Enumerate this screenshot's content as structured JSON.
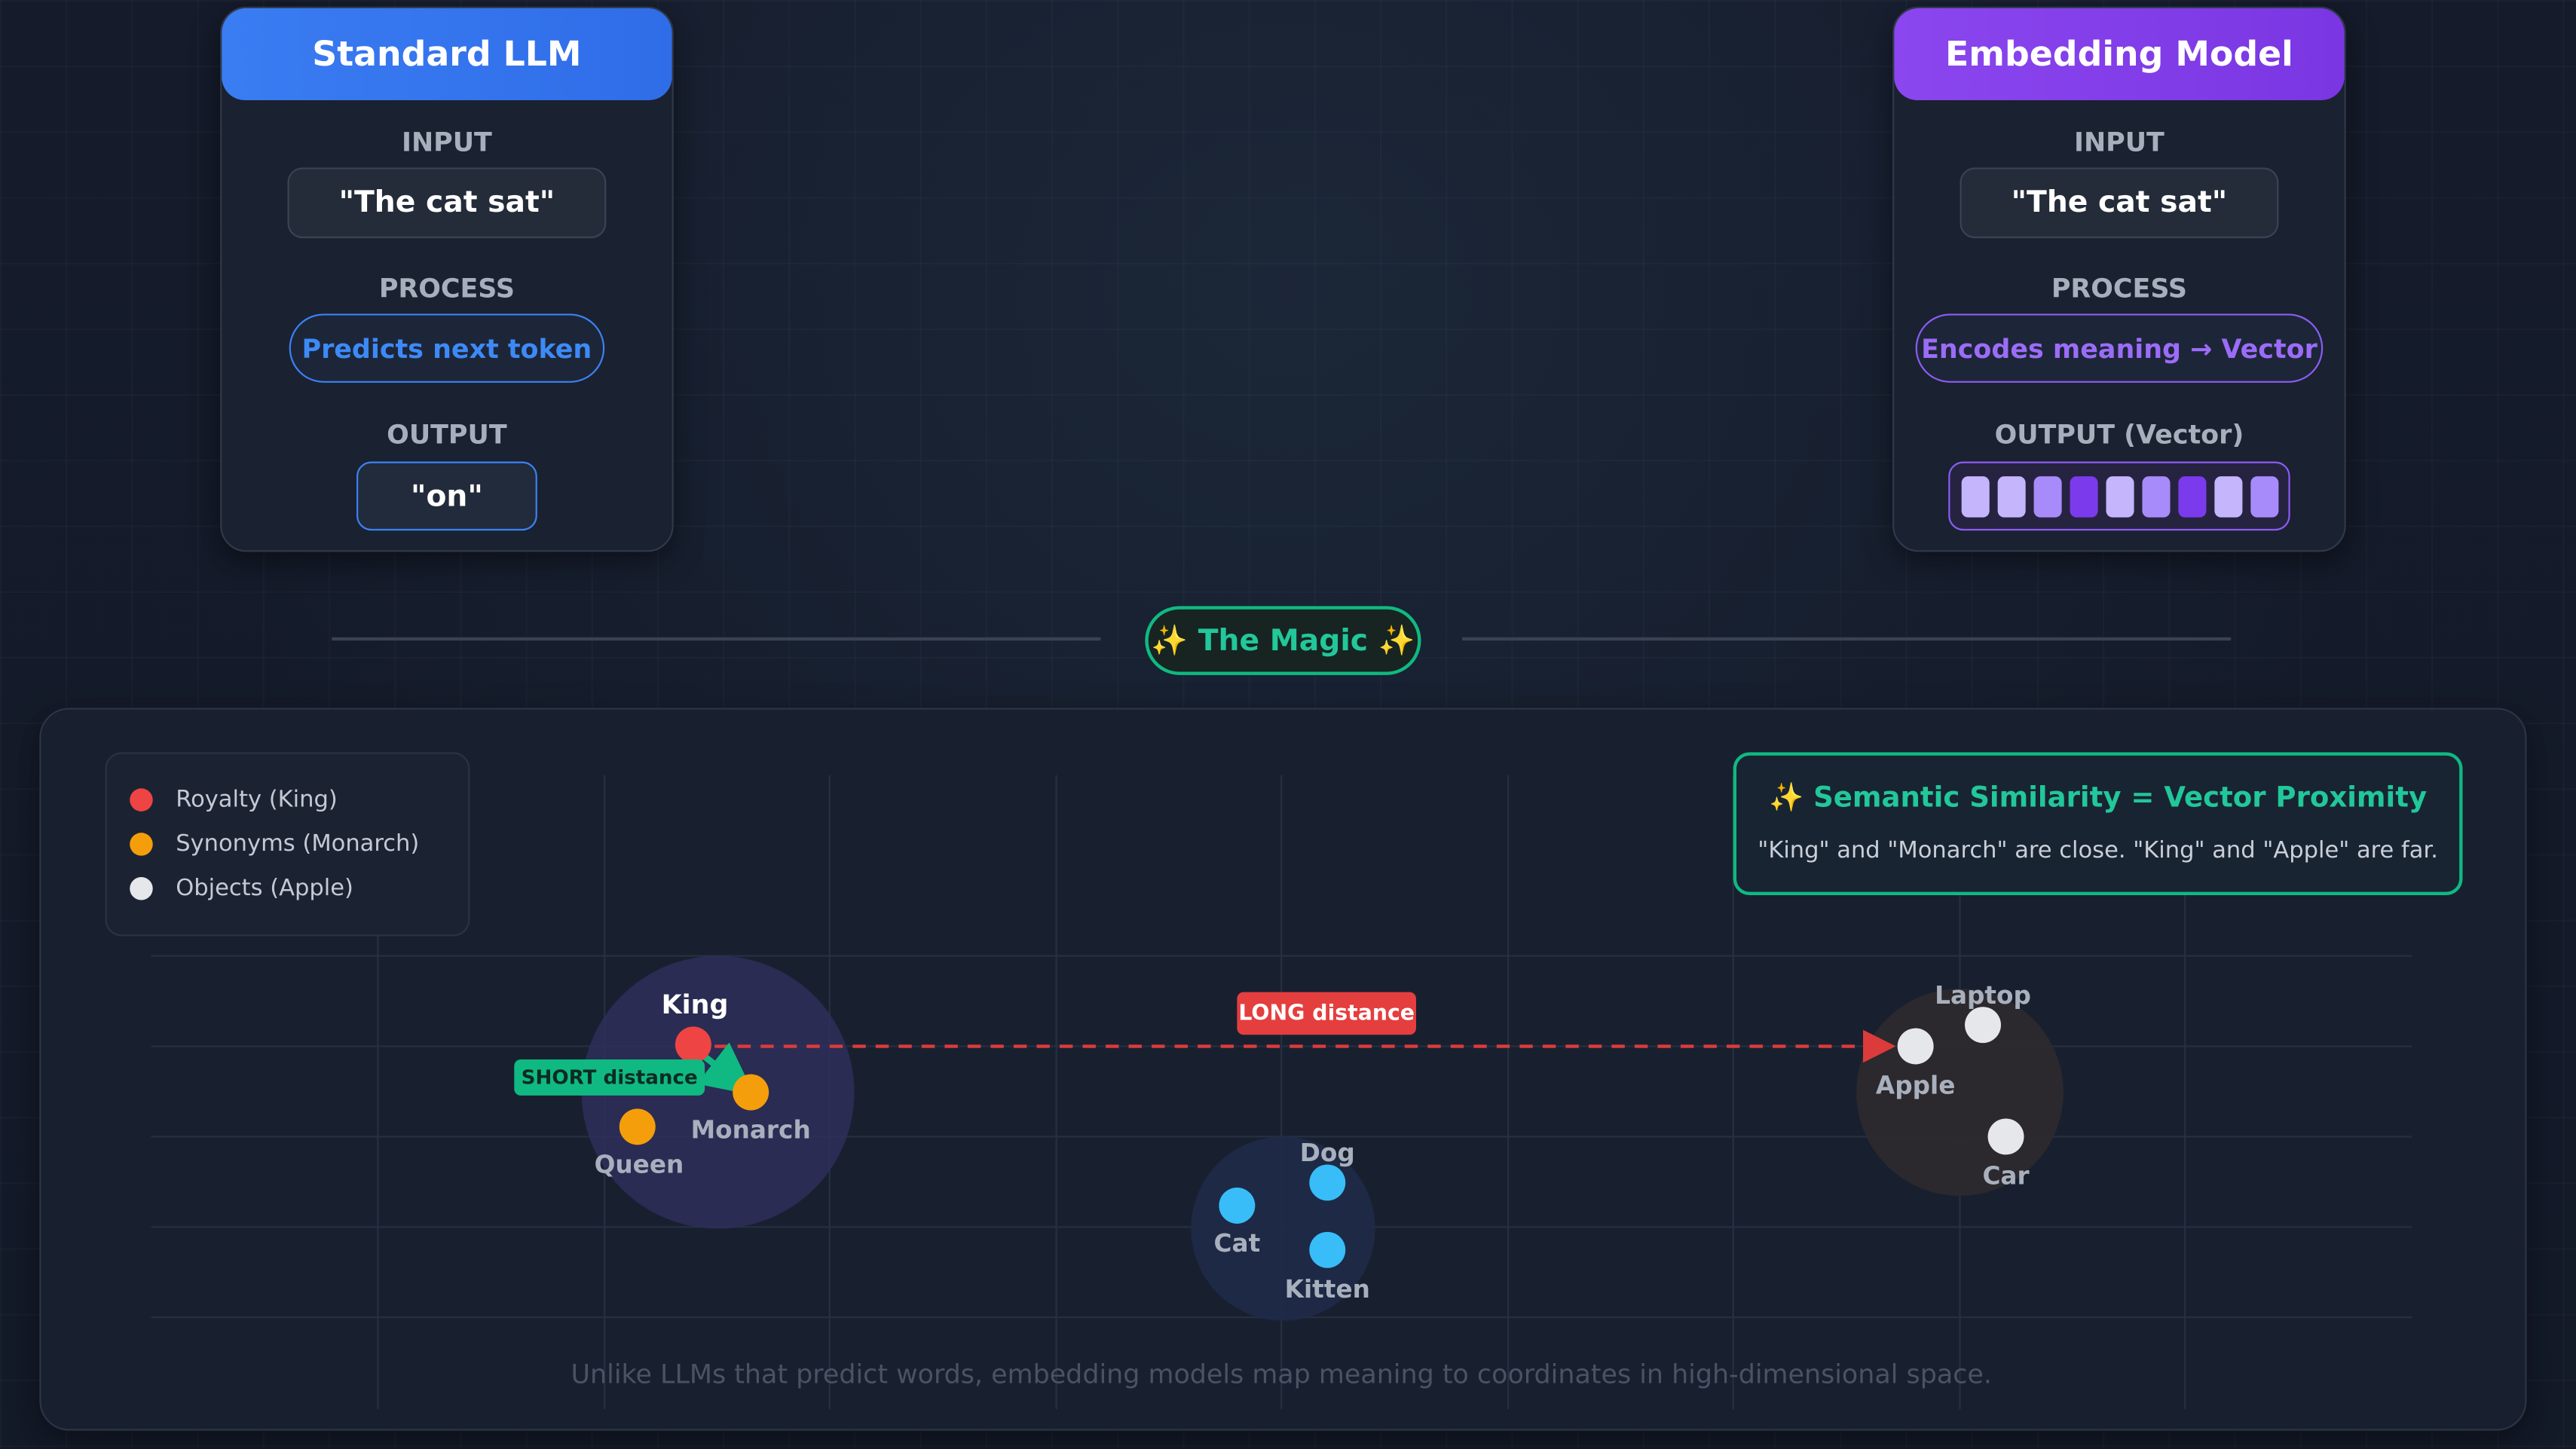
{
  "standard_llm": {
    "title": "Standard LLM",
    "input_label": "INPUT",
    "input_value": "\"The cat sat\"",
    "process_label": "PROCESS",
    "process_value": "Predicts next token",
    "output_label": "OUTPUT",
    "output_value": "\"on\""
  },
  "embedding_model": {
    "title": "Embedding Model",
    "input_label": "INPUT",
    "input_value": "\"The cat sat\"",
    "process_label": "PROCESS",
    "process_value": "Encodes meaning → Vector",
    "output_label": "OUTPUT (Vector)",
    "vector_cells": [
      "#c4b5fd",
      "#c4b5fd",
      "#a78bfa",
      "#7c3aed",
      "#c4b5fd",
      "#a78bfa",
      "#7c3aed",
      "#c4b5fd",
      "#a78bfa"
    ]
  },
  "divider": {
    "label": "✨ The Magic ✨"
  },
  "legend": {
    "items": [
      {
        "label": "Royalty (King)",
        "color": "#ef4444"
      },
      {
        "label": "Synonyms (Monarch)",
        "color": "#f59e0b"
      },
      {
        "label": "Objects (Apple)",
        "color": "#e5e7eb"
      }
    ]
  },
  "callout": {
    "title": "✨ Semantic Similarity = Vector Proximity",
    "subtitle": "\"King\" and \"Monarch\" are close. \"King\" and \"Apple\" are far."
  },
  "distance_labels": {
    "long": "LONG distance",
    "short": "SHORT distance"
  },
  "points": [
    {
      "label": "King",
      "color": "#ef4444"
    },
    {
      "label": "Monarch",
      "color": "#f59e0b"
    },
    {
      "label": "Queen",
      "color": "#f59e0b"
    },
    {
      "label": "Dog",
      "color": "#38bdf8"
    },
    {
      "label": "Cat",
      "color": "#38bdf8"
    },
    {
      "label": "Kitten",
      "color": "#38bdf8"
    },
    {
      "label": "Laptop",
      "color": "#e5e7eb"
    },
    {
      "label": "Apple",
      "color": "#e5e7eb"
    },
    {
      "label": "Car",
      "color": "#e5e7eb"
    }
  ],
  "footer": {
    "text": "Unlike LLMs that predict words, embedding models map meaning to coordinates in high-dimensional space."
  }
}
